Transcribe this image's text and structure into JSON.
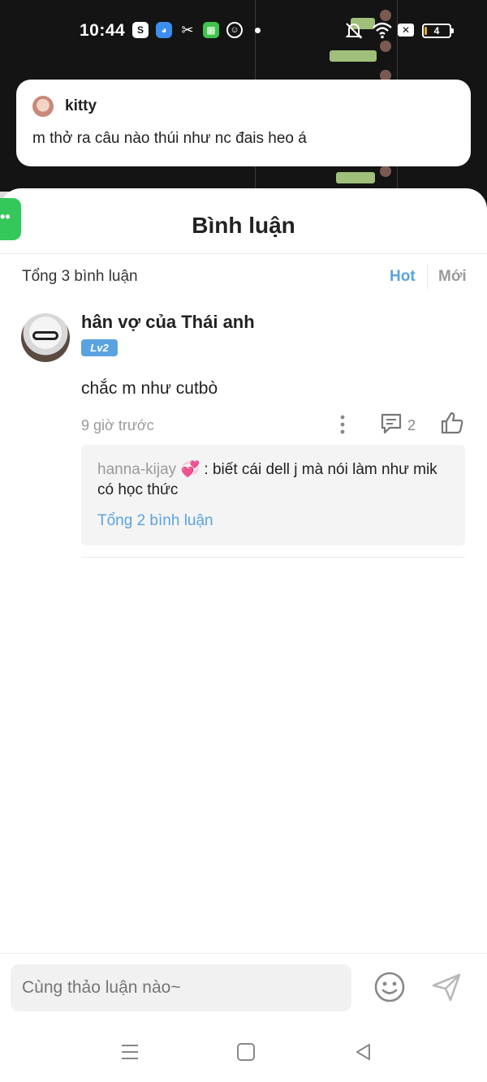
{
  "status_bar": {
    "time": "10:44",
    "battery": "4",
    "icons": [
      "shopee-icon",
      "browser-icon",
      "capcut-icon",
      "calculator-icon",
      "smile-icon",
      "notification-dot",
      "mute-icon",
      "wifi-icon",
      "close-box-icon",
      "battery-icon"
    ]
  },
  "notification": {
    "sender": "kitty",
    "message": "m thở ra câu nào thúi như nc đais heo á"
  },
  "sheet": {
    "title": "Bình luận",
    "total_label": "Tổng 3 bình luận",
    "sort_hot": "Hot",
    "sort_new": "Mới",
    "accent": "#5aa3e0"
  },
  "comment": {
    "author": "hân vợ của Thái anh",
    "badge": "Lv2",
    "text": "chắc m như cutbò",
    "time": "9 giờ trước",
    "reply_count": "2",
    "reply": {
      "author": "hanna-kijay",
      "emoji": "💞",
      "separator": ":",
      "text": "biết cái dell j mà nói làm như mik có học thức",
      "more": "Tổng 2 bình luận"
    }
  },
  "input": {
    "placeholder": "Cùng thảo luận nào~"
  }
}
